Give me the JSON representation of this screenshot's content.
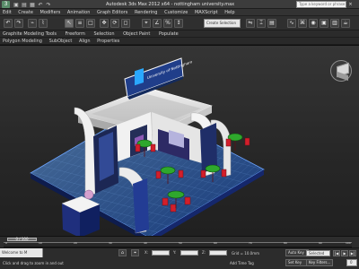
{
  "app": {
    "title": "Autodesk 3ds Max 2012 x64 - nottingham university.max",
    "search_placeholder": "Type a keyword or phrase",
    "logo_symbol": "3"
  },
  "menu": [
    "Edit",
    "Create",
    "Modifiers",
    "Animation",
    "Graph Editors",
    "Rendering",
    "Customize",
    "MAXScript",
    "Help"
  ],
  "toolbar": {
    "selection_set_label": "Create Selection Set",
    "icons": [
      "undo-icon",
      "redo-icon",
      "select-icon",
      "move-icon",
      "rotate-icon",
      "scale-icon",
      "snap-icon",
      "render-icon",
      "camera-icon"
    ]
  },
  "ribbon": {
    "tabs": [
      "Graphite Modeling Tools",
      "Freeform",
      "Selection",
      "Object Paint",
      "Populate"
    ],
    "panels": [
      "Polygon Modeling",
      "SubObject",
      "Align",
      "Properties"
    ]
  },
  "viewport": {
    "booth_sign": "University of Nottingham",
    "overlay_text": "Graphite Modeling Tools"
  },
  "timeline": {
    "slider_label": "0 / 100",
    "ruler_labels": [
      "0",
      "10",
      "20",
      "30",
      "40",
      "50",
      "60",
      "70",
      "80",
      "90",
      "100"
    ]
  },
  "status": {
    "maxscript": "Welcome to M",
    "x_label": "X:",
    "y_label": "Y:",
    "z_label": "Z:",
    "grid_text": "Grid = 10.0mm",
    "prompt_text": "Click and drag to zoom in and out",
    "add_time_tag": "Add Time Tag",
    "auto_key": "Auto Key",
    "set_key": "Set Key",
    "selected": "Selected",
    "key_filters": "Key Filters...",
    "frame": "0"
  }
}
